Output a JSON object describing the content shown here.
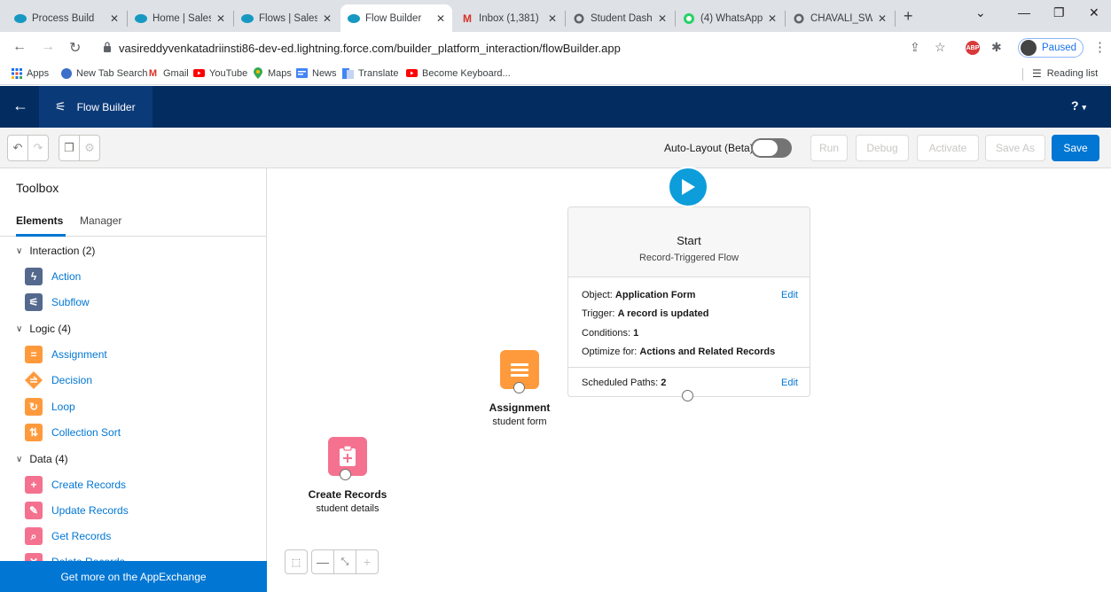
{
  "browser": {
    "tabs": [
      {
        "title": "Process Build",
        "icon": "salesforce-cloud-icon"
      },
      {
        "title": "Home | Sales",
        "icon": "salesforce-cloud-icon"
      },
      {
        "title": "Flows | Salesf",
        "icon": "salesforce-cloud-icon"
      },
      {
        "title": "Flow Builder",
        "icon": "salesforce-cloud-icon"
      },
      {
        "title": "Inbox (1,381)",
        "icon": "gmail-icon"
      },
      {
        "title": "Student Dash",
        "icon": "globe-icon"
      },
      {
        "title": "(4) WhatsApp",
        "icon": "whatsapp-icon"
      },
      {
        "title": "CHAVALI_SWI",
        "icon": "globe-icon"
      }
    ],
    "url": "vasireddyvenkatadriinsti86-dev-ed.lightning.force.com/builder_platform_interaction/flowBuilder.app",
    "profile_label": "Paused",
    "abp_label": "ABP",
    "bookmarks": [
      "Apps",
      "New Tab Search",
      "Gmail",
      "YouTube",
      "Maps",
      "News",
      "Translate",
      "Become Keyboard..."
    ],
    "reading_list": "Reading list"
  },
  "app": {
    "title": "Flow Builder",
    "help": "?"
  },
  "toolbar": {
    "autolayout_label": "Auto-Layout (Beta)",
    "run": "Run",
    "debug": "Debug",
    "activate": "Activate",
    "save_as": "Save As",
    "save": "Save"
  },
  "toolbox": {
    "title": "Toolbox",
    "tab_elements": "Elements",
    "tab_manager": "Manager",
    "sections": [
      {
        "label": "Interaction (2)"
      },
      {
        "label": "Logic (4)"
      },
      {
        "label": "Data (4)"
      }
    ],
    "items": [
      {
        "label": "Action",
        "color": "#54698d"
      },
      {
        "label": "Subflow",
        "color": "#54698d"
      },
      {
        "label": "Assignment",
        "color": "#ff9a3c"
      },
      {
        "label": "Decision",
        "color": "#ff9a3c"
      },
      {
        "label": "Loop",
        "color": "#ff9a3c"
      },
      {
        "label": "Collection Sort",
        "color": "#ff9a3c"
      },
      {
        "label": "Create Records",
        "color": "#f4728f"
      },
      {
        "label": "Update Records",
        "color": "#f4728f"
      },
      {
        "label": "Get Records",
        "color": "#f4728f"
      },
      {
        "label": "Delete Records",
        "color": "#f4728f"
      }
    ],
    "appexchange": "Get more on the AppExchange"
  },
  "canvas": {
    "start": {
      "title": "Start",
      "subtitle": "Record-Triggered Flow",
      "object_label": "Object:",
      "object_value": "Application Form",
      "trigger_label": "Trigger:",
      "trigger_value": "A record is updated",
      "conditions_label": "Conditions:",
      "conditions_value": "1",
      "optimize_label": "Optimize for:",
      "optimize_value": "Actions and Related Records",
      "scheduled_label": "Scheduled Paths:",
      "scheduled_value": "2",
      "edit": "Edit"
    },
    "assignment": {
      "title": "Assignment",
      "name": "student form",
      "color": "#ff9a3c"
    },
    "create_records": {
      "title": "Create Records",
      "name": "student details",
      "color": "#f4728f"
    }
  }
}
